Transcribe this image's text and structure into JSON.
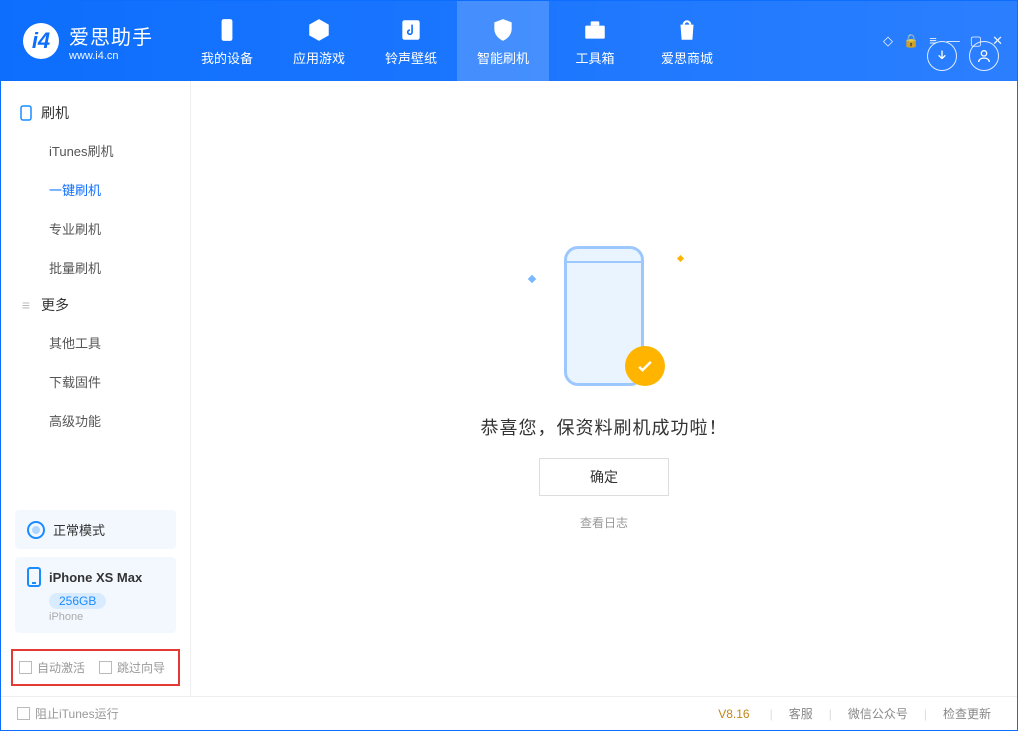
{
  "app": {
    "name": "爱思助手",
    "url": "www.i4.cn"
  },
  "nav": {
    "items": [
      {
        "label": "我的设备"
      },
      {
        "label": "应用游戏"
      },
      {
        "label": "铃声壁纸"
      },
      {
        "label": "智能刷机"
      },
      {
        "label": "工具箱"
      },
      {
        "label": "爱思商城"
      }
    ]
  },
  "sidebar": {
    "group1": {
      "title": "刷机",
      "items": [
        "iTunes刷机",
        "一键刷机",
        "专业刷机",
        "批量刷机"
      ]
    },
    "group2": {
      "title": "更多",
      "items": [
        "其他工具",
        "下载固件",
        "高级功能"
      ]
    },
    "mode": "正常模式",
    "device": {
      "name": "iPhone XS Max",
      "capacity": "256GB",
      "type": "iPhone"
    },
    "options": {
      "auto_activate": "自动激活",
      "skip_guide": "跳过向导"
    }
  },
  "main": {
    "message": "恭喜您，保资料刷机成功啦！",
    "ok_btn": "确定",
    "log_link": "查看日志"
  },
  "footer": {
    "block_itunes": "阻止iTunes运行",
    "version": "V8.16",
    "links": [
      "客服",
      "微信公众号",
      "检查更新"
    ]
  }
}
